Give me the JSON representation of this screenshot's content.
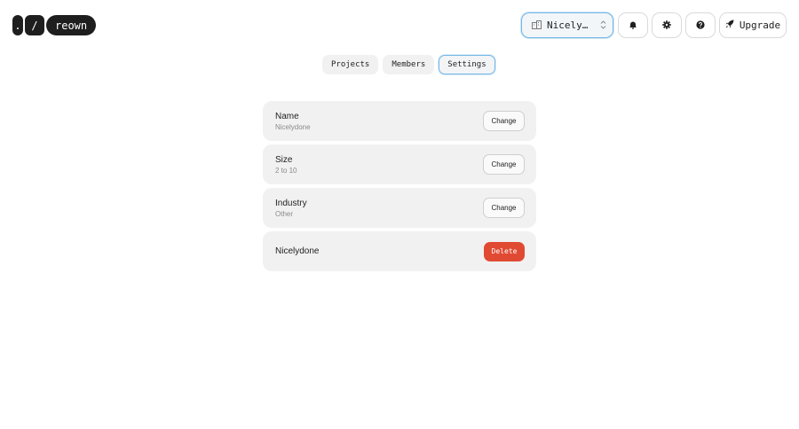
{
  "logo": {
    "dot": ".",
    "slash": "/",
    "word": "reown"
  },
  "header": {
    "org_select": {
      "icon": "building-icon",
      "name": "Nicelydone",
      "chevron": "chevron-updown-icon"
    },
    "notifications_icon": "bell-icon",
    "settings_icon": "gear-icon",
    "help_icon": "help-icon",
    "upgrade": {
      "icon": "rocket-icon",
      "label": "Upgrade"
    }
  },
  "tabs": [
    {
      "label": "Projects",
      "active": false
    },
    {
      "label": "Members",
      "active": false
    },
    {
      "label": "Settings",
      "active": true
    }
  ],
  "settings": {
    "rows": [
      {
        "label": "Name",
        "value": "Nicelydone",
        "action": "Change"
      },
      {
        "label": "Size",
        "value": "2 to 10",
        "action": "Change"
      },
      {
        "label": "Industry",
        "value": "Other",
        "action": "Change"
      }
    ],
    "danger": {
      "label": "Nicelydone",
      "action": "Delete"
    }
  },
  "colors": {
    "accent_border": "#76b7e6",
    "danger": "#e04a32",
    "card_bg": "#f1f1f1"
  }
}
